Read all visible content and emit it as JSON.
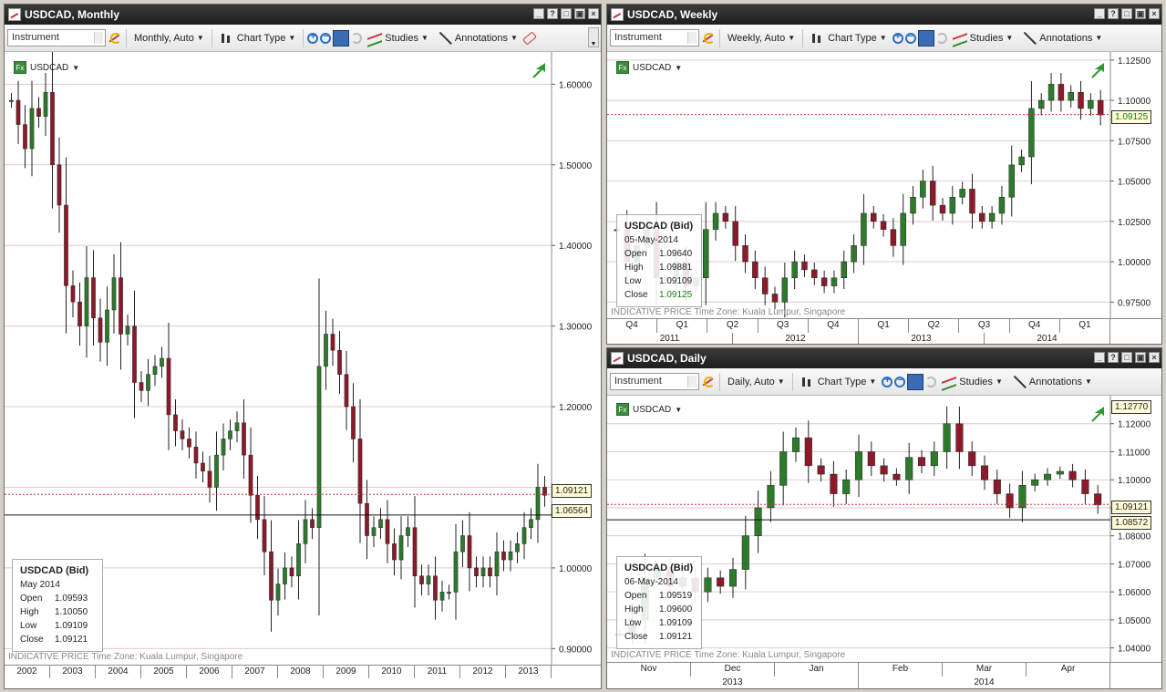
{
  "panels": {
    "monthly": {
      "title": "USDCAD, Monthly",
      "instrument_placeholder": "Instrument",
      "period": "Monthly,  Auto",
      "chart_type": "Chart Type",
      "studies": "Studies",
      "annotations": "Annotations",
      "symbol": "USDCAD",
      "fx": "Fx",
      "ohlc": {
        "title": "USDCAD (Bid)",
        "date": "May 2014",
        "open_label": "Open",
        "open": "1.09593",
        "high_label": "High",
        "high": "1.10050",
        "low_label": "Low",
        "low": "1.09109",
        "close_label": "Close",
        "close": "1.09121"
      },
      "footnote": "INDICATIVE PRICE   Time Zone: Kuala Lumpur, Singapore",
      "price_current": "1.09121",
      "price_line": "1.06564",
      "price_ticks": [
        "1.60000",
        "1.50000",
        "1.40000",
        "1.30000",
        "1.20000",
        "1.10000",
        "1.00000",
        "0.90000"
      ],
      "years": [
        "2002",
        "2003",
        "2004",
        "2005",
        "2006",
        "2007",
        "2008",
        "2009",
        "2010",
        "2011",
        "2012",
        "2013"
      ]
    },
    "weekly": {
      "title": "USDCAD, Weekly",
      "instrument_placeholder": "Instrument",
      "period": "Weekly,  Auto",
      "chart_type": "Chart Type",
      "studies": "Studies",
      "annotations": "Annotations",
      "symbol": "USDCAD",
      "fx": "Fx",
      "ohlc": {
        "title": "USDCAD (Bid)",
        "date": "05-May-2014",
        "open_label": "Open",
        "open": "1.09640",
        "high_label": "High",
        "high": "1.09881",
        "low_label": "Low",
        "low": "1.09109",
        "close_label": "Close",
        "close": "1.09125"
      },
      "footnote": "INDICATIVE PRICE   Time Zone: Kuala Lumpur, Singapore",
      "price_current": "1.09125",
      "price_ticks": [
        "1.12500",
        "1.10000",
        "1.07500",
        "1.05000",
        "1.02500",
        "1.00000",
        "0.97500"
      ],
      "quarters": [
        "Q4",
        "Q1",
        "Q2",
        "Q3",
        "Q4",
        "Q1",
        "Q2",
        "Q3",
        "Q4",
        "Q1"
      ],
      "years": [
        "2011",
        "2012",
        "2013",
        "2014"
      ]
    },
    "daily": {
      "title": "USDCAD, Daily",
      "instrument_placeholder": "Instrument",
      "period": "Daily,  Auto",
      "chart_type": "Chart Type",
      "studies": "Studies",
      "annotations": "Annotations",
      "symbol": "USDCAD",
      "fx": "Fx",
      "ohlc": {
        "title": "USDCAD (Bid)",
        "date": "06-May-2014",
        "open_label": "Open",
        "open": "1.09519",
        "high_label": "High",
        "high": "1.09600",
        "low_label": "Low",
        "low": "1.09109",
        "close_label": "Close",
        "close": "1.09121"
      },
      "footnote": "INDICATIVE PRICE   Time Zone: Kuala Lumpur, Singapore",
      "price_high": "1.12770",
      "price_current": "1.09121",
      "price_line": "1.08572",
      "price_ticks": [
        "1.12000",
        "1.11000",
        "1.10000",
        "1.09000",
        "1.08000",
        "1.07000",
        "1.06000",
        "1.05000",
        "1.04000"
      ],
      "months": [
        "Nov",
        "Dec",
        "Jan",
        "Feb",
        "Mar",
        "Apr"
      ],
      "years": [
        "2013",
        "2014"
      ]
    }
  },
  "chart_data": [
    {
      "type": "candlestick",
      "series": [
        {
          "name": "USDCAD",
          "values": [
            1.58,
            1.55,
            1.52,
            1.57,
            1.56,
            1.59,
            1.5,
            1.45,
            1.35,
            1.33,
            1.3,
            1.36,
            1.31,
            1.28,
            1.32,
            1.36,
            1.29,
            1.3,
            1.23,
            1.22,
            1.24,
            1.25,
            1.26,
            1.19,
            1.17,
            1.16,
            1.15,
            1.13,
            1.12,
            1.1,
            1.14,
            1.16,
            1.17,
            1.18,
            1.14,
            1.09,
            1.06,
            1.02,
            0.96,
            0.98,
            1.0,
            0.99,
            1.03,
            1.06,
            1.05,
            1.25,
            1.29,
            1.27,
            1.24,
            1.2,
            1.16,
            1.08,
            1.04,
            1.05,
            1.06,
            1.03,
            1.01,
            1.04,
            1.05,
            0.99,
            0.98,
            0.99,
            0.96,
            0.97,
            0.97,
            1.02,
            1.04,
            1.0,
            0.99,
            1.0,
            0.99,
            1.02,
            1.01,
            1.02,
            1.03,
            1.05,
            1.06,
            1.1,
            1.09
          ]
        }
      ],
      "ylim": [
        0.88,
        1.64
      ]
    },
    {
      "type": "candlestick",
      "series": [
        {
          "name": "USDCAD",
          "values": [
            1.02,
            1.0,
            1.01,
            1.02,
            0.99,
            0.99,
            1.0,
            0.985,
            0.99,
            1.02,
            1.03,
            1.025,
            1.01,
            1.0,
            0.99,
            0.98,
            0.975,
            0.99,
            1.0,
            0.995,
            0.99,
            0.985,
            0.99,
            1.0,
            1.01,
            1.03,
            1.025,
            1.02,
            1.01,
            1.03,
            1.04,
            1.05,
            1.035,
            1.03,
            1.04,
            1.045,
            1.03,
            1.025,
            1.03,
            1.04,
            1.06,
            1.065,
            1.095,
            1.1,
            1.11,
            1.1,
            1.105,
            1.095,
            1.1,
            1.091
          ]
        }
      ],
      "ylim": [
        0.965,
        1.13
      ]
    },
    {
      "type": "candlestick",
      "series": [
        {
          "name": "USDCAD",
          "values": [
            1.045,
            1.05,
            1.065,
            1.068,
            1.062,
            1.065,
            1.06,
            1.065,
            1.062,
            1.068,
            1.08,
            1.09,
            1.098,
            1.11,
            1.115,
            1.105,
            1.102,
            1.095,
            1.1,
            1.11,
            1.105,
            1.102,
            1.1,
            1.108,
            1.105,
            1.11,
            1.12,
            1.11,
            1.105,
            1.1,
            1.095,
            1.09,
            1.098,
            1.1,
            1.102,
            1.103,
            1.1,
            1.095,
            1.091
          ]
        }
      ],
      "ylim": [
        1.035,
        1.13
      ]
    }
  ]
}
